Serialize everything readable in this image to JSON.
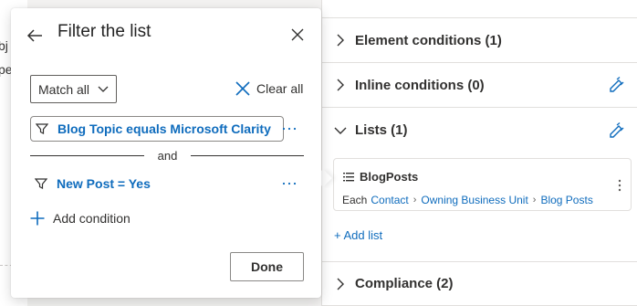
{
  "background": {
    "left_fragments": [
      "bj",
      "pe"
    ]
  },
  "popup": {
    "title": "Filter the list",
    "match_select": {
      "selected": "Match all"
    },
    "clear_all_label": "Clear all",
    "conditions": [
      {
        "text": "Blog Topic equals Microsoft Clarity",
        "more": "···"
      },
      {
        "text": "New Post = Yes",
        "more": "···"
      }
    ],
    "connector": "and",
    "add_condition_label": "Add condition",
    "done_label": "Done"
  },
  "panel": {
    "sections": [
      {
        "title": "Element conditions (1)"
      },
      {
        "title": "Inline conditions (0)"
      },
      {
        "title": "Lists (1)"
      },
      {
        "title": "Compliance (2)"
      }
    ],
    "list_card": {
      "name": "BlogPosts",
      "each_label": "Each",
      "breadcrumb": [
        "Contact",
        "Owning Business Unit",
        "Blog Posts"
      ]
    },
    "add_list_label": "+ Add list"
  },
  "colors": {
    "link_blue": "#0f6cbd",
    "text": "#323130",
    "border": "#e1dfdd"
  }
}
